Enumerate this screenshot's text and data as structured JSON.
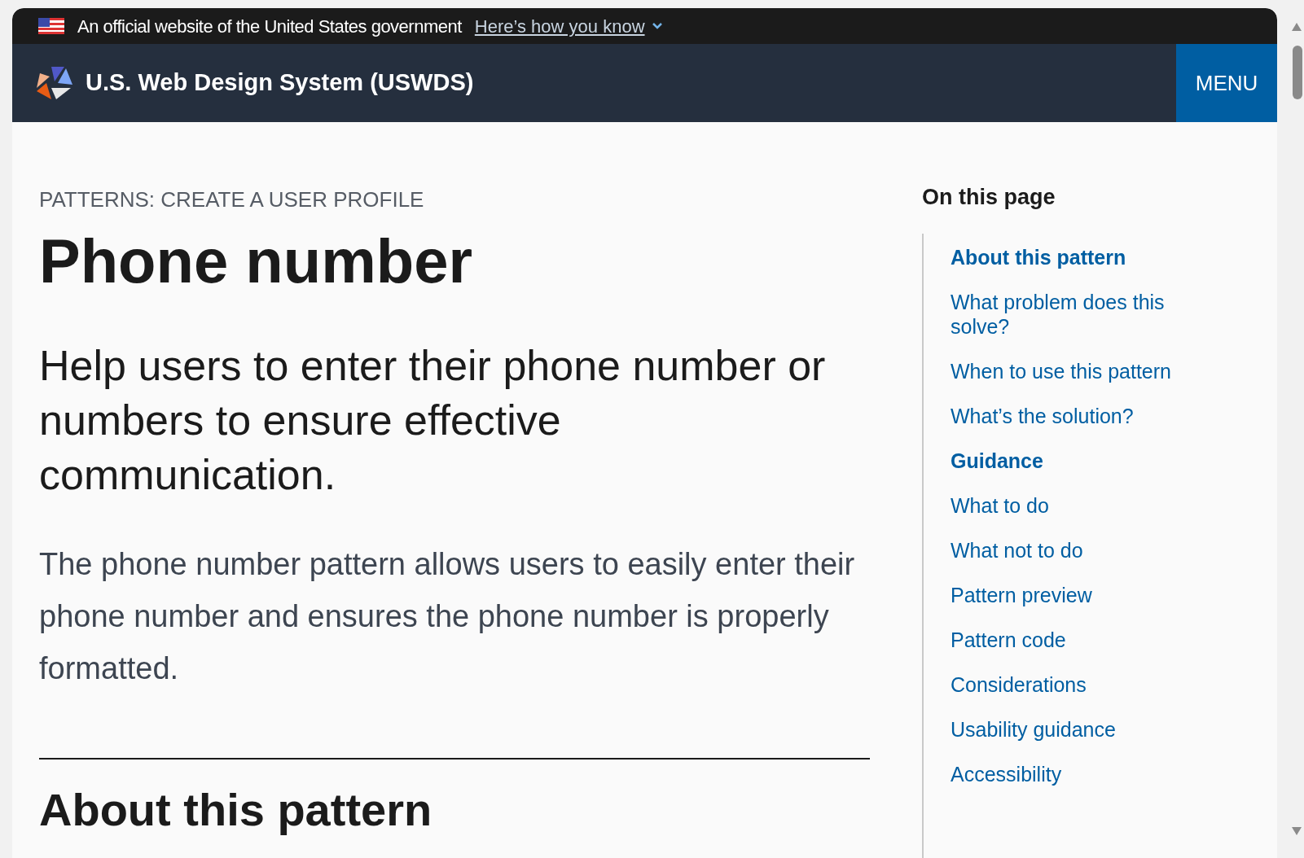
{
  "gov_banner": {
    "text": "An official website of the United States government",
    "link": "Here’s how you know"
  },
  "header": {
    "title": "U.S. Web Design System (USWDS)",
    "menu_button": "MENU"
  },
  "main": {
    "breadcrumb": "PATTERNS: CREATE A USER PROFILE",
    "title": "Phone number",
    "lead": "Help users to enter their phone number or numbers to ensure effective communication.",
    "body": "The phone number pattern allows users to easily enter their phone number and ensures the phone number is properly formatted.",
    "section_heading": "About this pattern"
  },
  "on_this_page": {
    "heading": "On this page",
    "items": [
      {
        "label": "About this pattern",
        "kind": "section"
      },
      {
        "label": "What problem does this solve?",
        "kind": "link"
      },
      {
        "label": "When to use this pattern",
        "kind": "link"
      },
      {
        "label": "What’s the solution?",
        "kind": "link"
      },
      {
        "label": "Guidance",
        "kind": "section"
      },
      {
        "label": "What to do",
        "kind": "link"
      },
      {
        "label": "What not to do",
        "kind": "link"
      },
      {
        "label": "Pattern preview",
        "kind": "link"
      },
      {
        "label": "Pattern code",
        "kind": "link"
      },
      {
        "label": "Considerations",
        "kind": "link"
      },
      {
        "label": "Usability guidance",
        "kind": "link"
      },
      {
        "label": "Accessibility",
        "kind": "link"
      }
    ]
  }
}
